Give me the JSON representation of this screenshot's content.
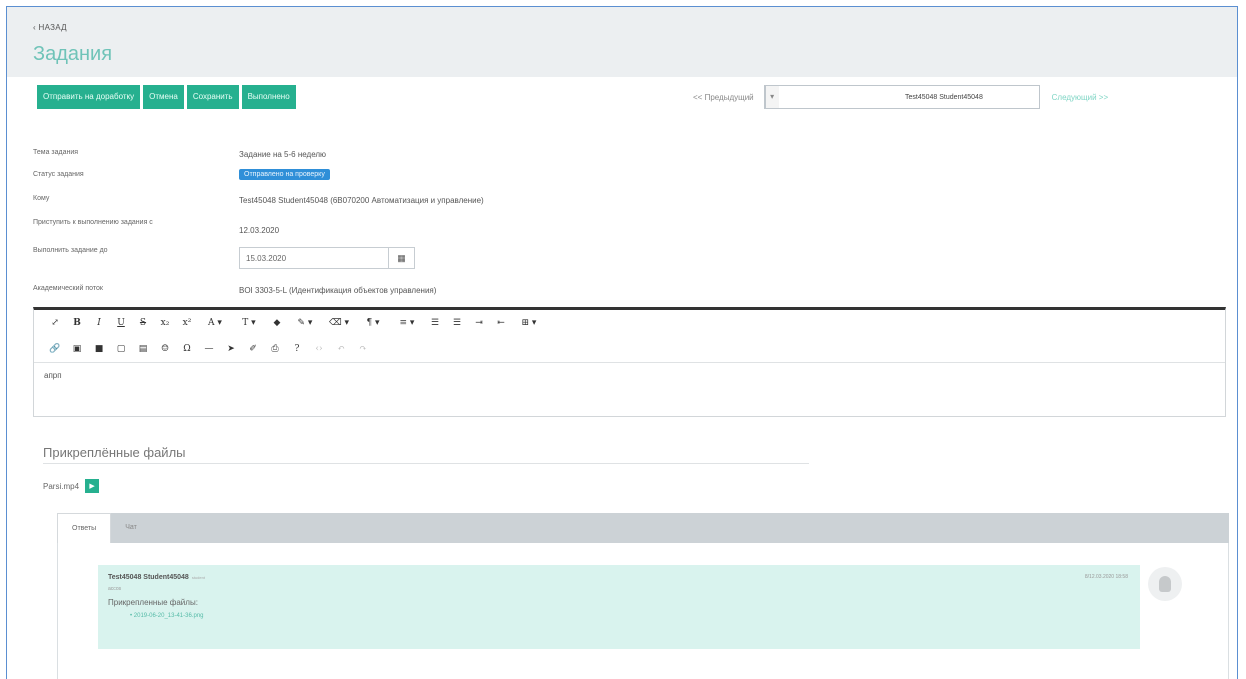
{
  "header": {
    "back_label": "‹ НАЗАД",
    "title": "Задания"
  },
  "toolbar": {
    "revise_label": "Отправить на доработку",
    "cancel_label": "Отмена",
    "save_label": "Сохранить",
    "complete_label": "Выполнено"
  },
  "navigation": {
    "prev_label": "<< Предыдущий",
    "student_value": "Test45048 Student45048",
    "next_label": "Следующий >>"
  },
  "form": {
    "topic_label": "Тема задания",
    "topic_value": "Задание на 5-6 неделю",
    "status_label": "Статус задания",
    "status_value": "Отправлено на проверку",
    "to_whom_label": "Кому",
    "to_whom_value": "Test45048 Student45048 (6B070200 Автоматизация и управление)",
    "start_label": "Приступить к выполнению задания с",
    "start_value": "12.03.2020",
    "due_label": "Выполнить задание до",
    "due_value": "15.03.2020",
    "stream_label": "Академический поток",
    "stream_value": "BOI 3303-5-L (Идентификация объектов управления)"
  },
  "editor": {
    "content": "апрп"
  },
  "attachments": {
    "title": "Прикреплённые файлы",
    "file_name": "Parsi.mp4"
  },
  "tabs": [
    {
      "label": "Ответы"
    },
    {
      "label": "Чат"
    }
  ],
  "message": {
    "author": "Test45048 Student45048",
    "author_meta": "student",
    "subtitle": "ассоs",
    "attachments_label": "Прикрепленные файлы:",
    "file_link": "• 2019-06-20_13-41-36.png",
    "timestamp": "8/12.03.2020 18:58"
  }
}
